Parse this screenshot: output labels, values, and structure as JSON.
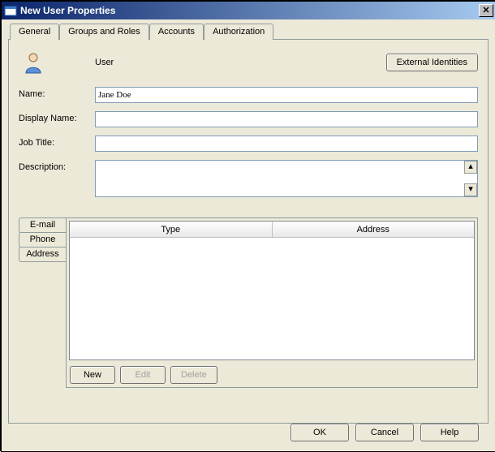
{
  "window": {
    "title": "New User Properties"
  },
  "tabs": {
    "general": "General",
    "groups": "Groups and Roles",
    "accounts": "Accounts",
    "authorization": "Authorization"
  },
  "general": {
    "type_label": "User",
    "external_identities": "External Identities",
    "fields": {
      "name_label": "Name:",
      "name_value": "Jane Doe",
      "display_name_label": "Display Name:",
      "display_name_value": "",
      "job_title_label": "Job Title:",
      "job_title_value": "",
      "description_label": "Description:",
      "description_value": ""
    }
  },
  "contacts": {
    "side_tabs": {
      "email": "E-mail",
      "phone": "Phone",
      "address": "Address"
    },
    "columns": {
      "type": "Type",
      "address": "Address"
    },
    "rows": [],
    "actions": {
      "new": "New",
      "edit": "Edit",
      "delete": "Delete"
    }
  },
  "footer": {
    "ok": "OK",
    "cancel": "Cancel",
    "help": "Help"
  }
}
